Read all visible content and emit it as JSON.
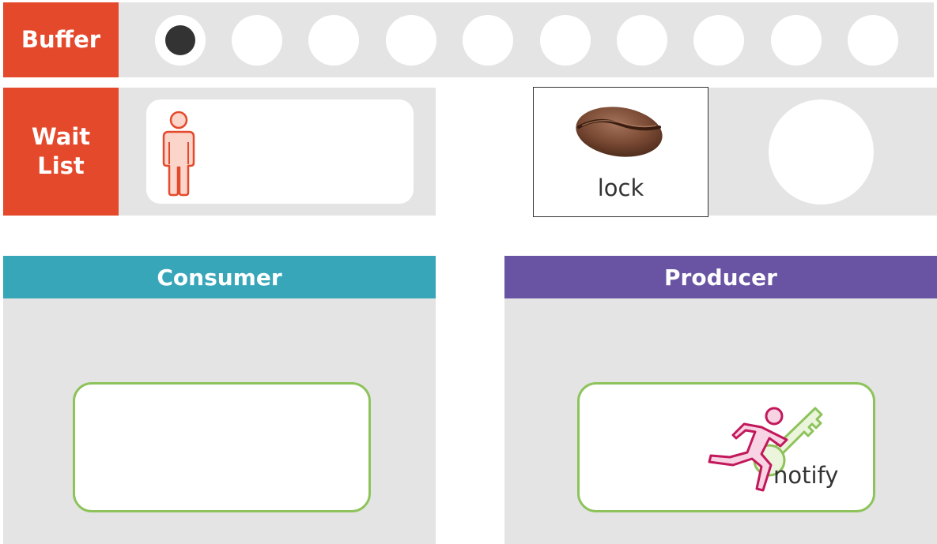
{
  "buffer": {
    "label": "Buffer",
    "slot_count": 10,
    "filled_slots": [
      0
    ],
    "slot_colors": {
      "empty": "#ffffff",
      "filled": "#333333"
    }
  },
  "wait_list": {
    "label_line1": "Wait",
    "label_line2": "List",
    "waiting": [
      {
        "icon": "person-outline-icon",
        "color": "#e5492c"
      }
    ]
  },
  "lock": {
    "label": "lock",
    "holder_icon": "coffee-bean-icon",
    "queue_slot_icon": "empty-circle"
  },
  "consumer": {
    "title": "Consumer",
    "header_color": "#38a6b9",
    "action": ""
  },
  "producer": {
    "title": "Producer",
    "header_color": "#6953a3",
    "action": "notify",
    "action_icon": "runner-with-key-icon"
  },
  "colors": {
    "label_red": "#e5492c",
    "panel_gray": "#e4e4e4",
    "slot_border_green": "#8dc35a",
    "person_pink": "#c2185b",
    "key_green": "#8dc35a"
  }
}
